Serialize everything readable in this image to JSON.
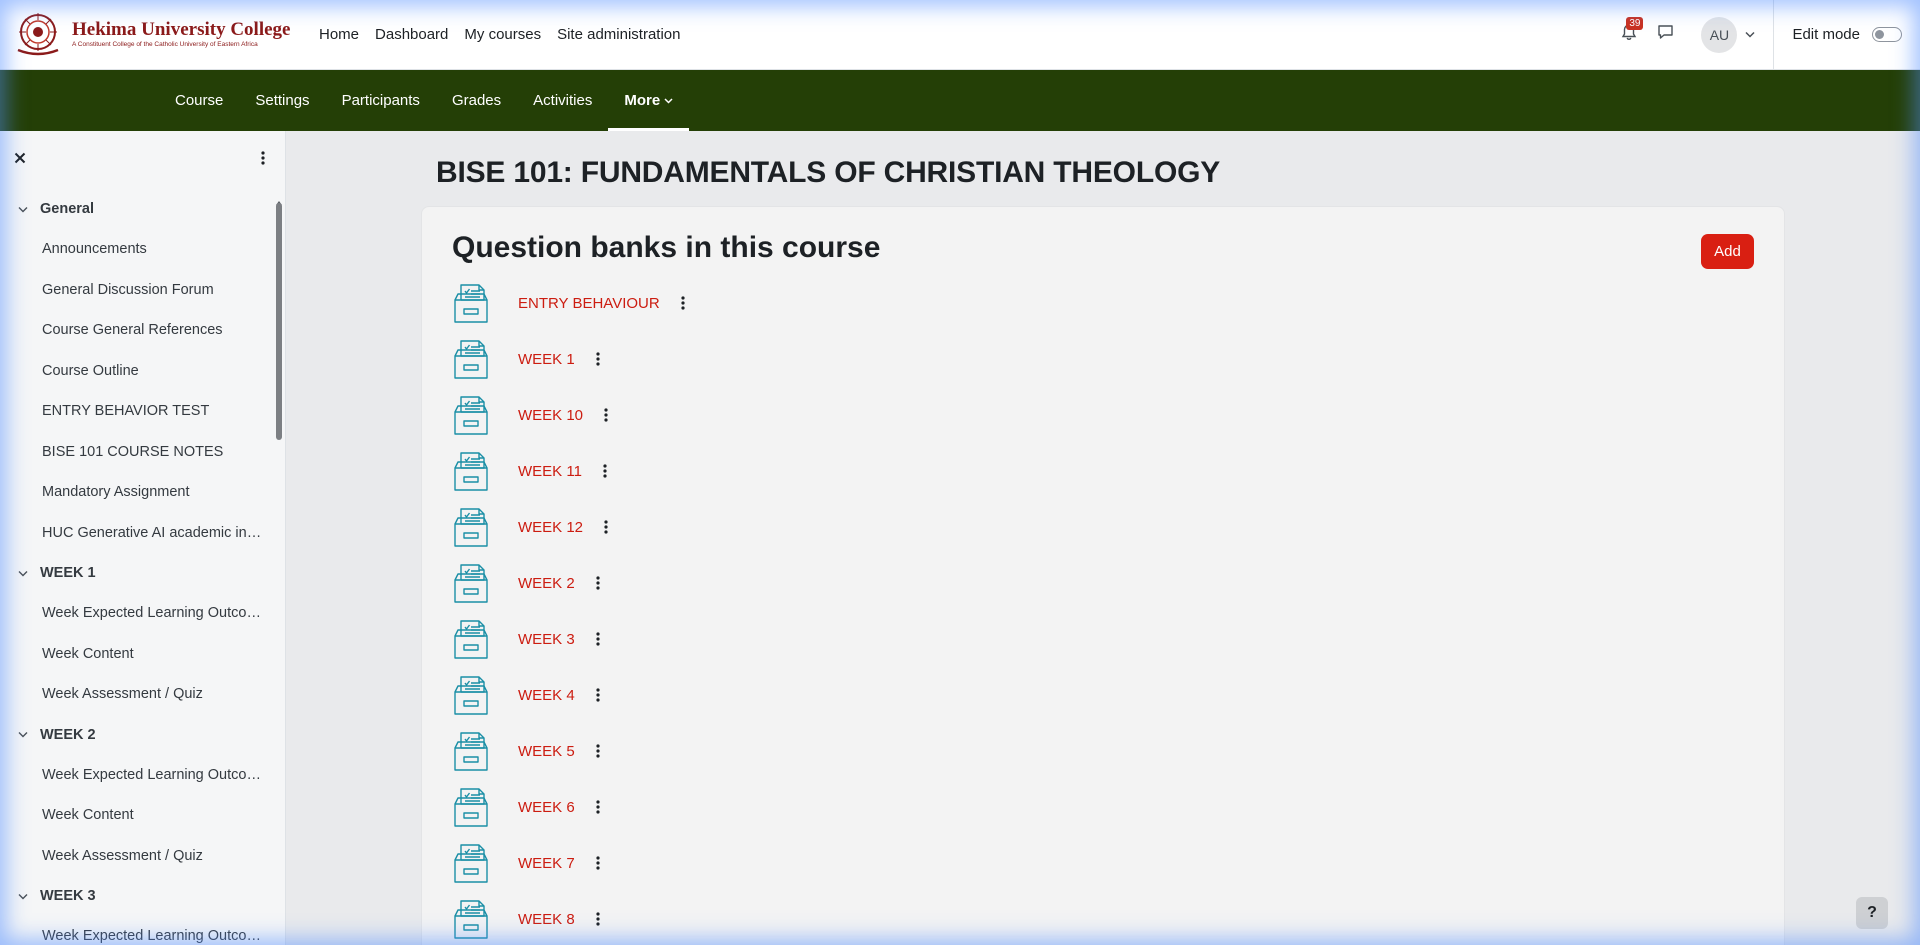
{
  "brand": {
    "name": "Hekima University College",
    "subtitle": "A Constituent College of the Catholic University of Eastern Africa"
  },
  "primary_nav": [
    "Home",
    "Dashboard",
    "My courses",
    "Site administration"
  ],
  "top_right": {
    "notification_count": "39",
    "avatar_initials": "AU",
    "edit_mode_label": "Edit mode"
  },
  "secondary_nav": [
    {
      "label": "Course"
    },
    {
      "label": "Settings"
    },
    {
      "label": "Participants"
    },
    {
      "label": "Grades"
    },
    {
      "label": "Activities"
    },
    {
      "label": "More",
      "active": true
    }
  ],
  "course_index": [
    {
      "section": "General",
      "items": [
        "Announcements",
        "General Discussion Forum",
        "Course General References",
        "Course Outline",
        "ENTRY BEHAVIOR TEST",
        "BISE 101 COURSE NOTES",
        "Mandatory Assignment",
        "HUC Generative AI academic in…"
      ]
    },
    {
      "section": "WEEK 1",
      "items": [
        "Week Expected Learning Outco…",
        "Week Content",
        "Week Assessment / Quiz"
      ]
    },
    {
      "section": "WEEK 2",
      "items": [
        "Week Expected Learning Outco…",
        "Week Content",
        "Week Assessment / Quiz"
      ]
    },
    {
      "section": "WEEK 3",
      "items": [
        "Week Expected Learning Outco…"
      ]
    }
  ],
  "page_title": "BISE 101: FUNDAMENTALS OF CHRISTIAN THEOLOGY",
  "card": {
    "title": "Question banks in this course",
    "add_label": "Add"
  },
  "question_banks": [
    "ENTRY BEHAVIOUR",
    "WEEK 1",
    "WEEK 10",
    "WEEK 11",
    "WEEK 12",
    "WEEK 2",
    "WEEK 3",
    "WEEK 4",
    "WEEK 5",
    "WEEK 6",
    "WEEK 7",
    "WEEK 8"
  ],
  "help_label": "?",
  "colors": {
    "secondary_nav_bg": "#243f06",
    "accent_red": "#d91f12",
    "link_red": "#cc1c10",
    "bank_icon_teal": "#1b8fa6",
    "brand_maroon": "#8b1a1a"
  }
}
